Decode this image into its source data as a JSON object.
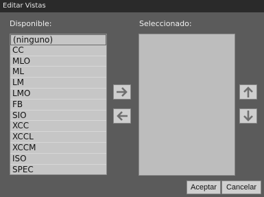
{
  "window": {
    "title": "Editar Vistas"
  },
  "labels": {
    "available": "Disponible:",
    "selected": "Seleccionado:"
  },
  "available_items": [
    "(ninguno)",
    "CC",
    "MLO",
    "ML",
    "LM",
    "LMO",
    "FB",
    "SIO",
    "XCC",
    "XCCL",
    "XCCM",
    "ISO",
    "SPEC"
  ],
  "selected_items": [],
  "buttons": {
    "ok": "Aceptar",
    "cancel": "Cancelar"
  },
  "icons": {
    "add": "arrow-right-icon",
    "remove": "arrow-left-icon",
    "move_up": "arrow-up-icon",
    "move_down": "arrow-down-icon"
  }
}
